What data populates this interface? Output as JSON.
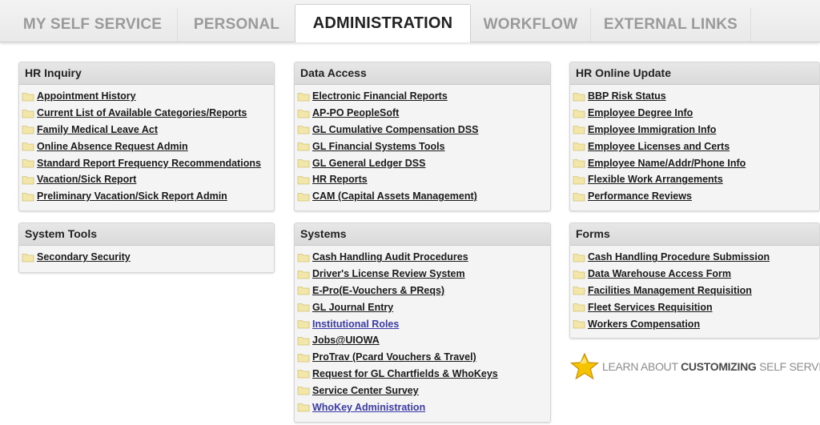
{
  "tabs": [
    {
      "label": "MY SELF SERVICE"
    },
    {
      "label": "PERSONAL"
    },
    {
      "label": "ADMINISTRATION"
    },
    {
      "label": "WORKFLOW"
    },
    {
      "label": "EXTERNAL LINKS"
    }
  ],
  "active_tab": "ADMINISTRATION",
  "panels": {
    "hr_inquiry": {
      "title": "HR Inquiry",
      "links": [
        "Appointment History",
        "Current List of Available Categories/Reports",
        "Family Medical Leave Act",
        "Online Absence Request Admin",
        "Standard Report Frequency Recommendations",
        "Vacation/Sick Report",
        "Preliminary Vacation/Sick Report Admin"
      ]
    },
    "data_access": {
      "title": "Data Access",
      "links": [
        "Electronic Financial Reports",
        "AP-PO PeopleSoft",
        "GL Cumulative Compensation DSS",
        "GL Financial Systems Tools",
        "GL General Ledger DSS",
        "HR Reports",
        "CAM (Capital Assets Management)"
      ]
    },
    "hr_online_update": {
      "title": "HR Online Update",
      "links": [
        "BBP Risk Status",
        "Employee Degree Info",
        "Employee Immigration Info",
        "Employee Licenses and Certs",
        "Employee Name/Addr/Phone Info",
        "Flexible Work Arrangements",
        "Performance Reviews"
      ]
    },
    "system_tools": {
      "title": "System Tools",
      "links": [
        "Secondary Security"
      ]
    },
    "systems": {
      "title": "Systems",
      "links": [
        "Cash Handling Audit Procedures",
        "Driver's License Review System",
        "E-Pro(E-Vouchers & PReqs)",
        "GL Journal Entry",
        "Institutional Roles",
        "Jobs@UIOWA",
        "ProTrav (Pcard Vouchers & Travel)",
        "Request for GL Chartfields & WhoKeys",
        "Service Center Survey",
        "WhoKey Administration"
      ],
      "visited": [
        "Institutional Roles",
        "WhoKey Administration"
      ]
    },
    "forms": {
      "title": "Forms",
      "links": [
        "Cash Handling Procedure Submission",
        "Data Warehouse Access Form",
        "Facilities Management Requisition",
        "Fleet Services Requisition",
        "Workers Compensation"
      ]
    }
  },
  "learn_about": {
    "prefix": "LEARN ABOUT ",
    "emphasis": "CUSTOMIZING",
    "suffix": " SELF SERVICE",
    "icon": "star-icon"
  },
  "colors": {
    "link": "#1a1a1a",
    "visited_link": "#3a3aa8",
    "folder": "#f2e6a8",
    "star": "#f6c300"
  }
}
